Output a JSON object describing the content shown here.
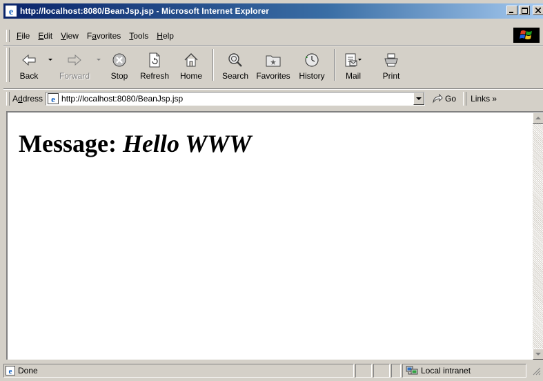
{
  "window": {
    "title": "http://localhost:8080/BeanJsp.jsp - Microsoft Internet Explorer"
  },
  "menu": {
    "items": [
      "File",
      "Edit",
      "View",
      "Favorites",
      "Tools",
      "Help"
    ],
    "accelerators": [
      "F",
      "E",
      "V",
      "a",
      "T",
      "H"
    ]
  },
  "toolbar": {
    "back": "Back",
    "forward": "Forward",
    "stop": "Stop",
    "refresh": "Refresh",
    "home": "Home",
    "search": "Search",
    "favorites": "Favorites",
    "history": "History",
    "mail": "Mail",
    "print": "Print"
  },
  "address": {
    "label": "Address",
    "url": "http://localhost:8080/BeanJsp.jsp",
    "go": "Go",
    "links": "Links"
  },
  "page": {
    "heading_label": "Message:",
    "heading_value": "Hello WWW"
  },
  "status": {
    "text": "Done",
    "zone": "Local intranet"
  },
  "colors": {
    "title_start": "#0a246a",
    "title_end": "#a6caf0",
    "chrome": "#d4d0c8"
  }
}
